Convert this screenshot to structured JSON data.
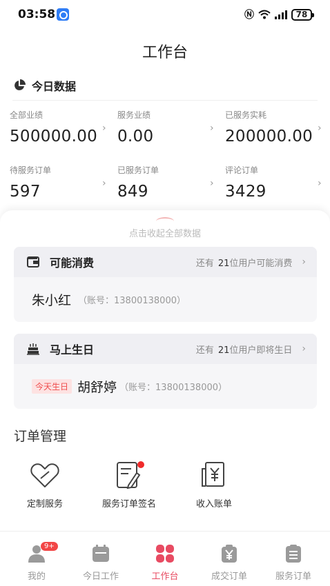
{
  "status_bar": {
    "time": "03:58",
    "battery": "78"
  },
  "header": {
    "title": "工作台"
  },
  "today": {
    "title": "今日数据",
    "stats": [
      {
        "label": "全部业绩",
        "value": "500000.00"
      },
      {
        "label": "服务业绩",
        "value": "0.00"
      },
      {
        "label": "已服务实耗",
        "value": "200000.00"
      },
      {
        "label": "待服务订单",
        "value": "597"
      },
      {
        "label": "已服务订单",
        "value": "849"
      },
      {
        "label": "评论订单",
        "value": "3429"
      }
    ],
    "collapse_text": "点击收起全部数据"
  },
  "possible_consumption": {
    "title": "可能消费",
    "note_prefix": "还有",
    "note_count": "21",
    "note_suffix": "位用户可能消费",
    "person": {
      "name": "朱小红",
      "account": "（账号：13800138000）"
    }
  },
  "birthday": {
    "title": "马上生日",
    "note_prefix": "还有",
    "note_count": "21",
    "note_suffix": "位用户即将生日",
    "tag": "今天生日",
    "person": {
      "name": "胡舒婷",
      "account": "（账号：13800138000）"
    }
  },
  "orders": {
    "title": "订单管理",
    "items": [
      {
        "label": "定制服务",
        "icon": "heart-tag-icon"
      },
      {
        "label": "服务订单签名",
        "icon": "sign-document-icon"
      },
      {
        "label": "收入账单",
        "icon": "income-bill-icon"
      }
    ]
  },
  "tabs": [
    {
      "label": "我的",
      "badge": "9+",
      "icon": "user-icon"
    },
    {
      "label": "今日工作",
      "icon": "calendar-icon"
    },
    {
      "label": "工作台",
      "icon": "grid-icon",
      "active": true
    },
    {
      "label": "成交订单",
      "icon": "yuan-bag-icon"
    },
    {
      "label": "服务订单",
      "icon": "clipboard-icon"
    }
  ],
  "colors": {
    "accent": "#e84b62",
    "badge": "#f24646",
    "muted": "#999999"
  }
}
